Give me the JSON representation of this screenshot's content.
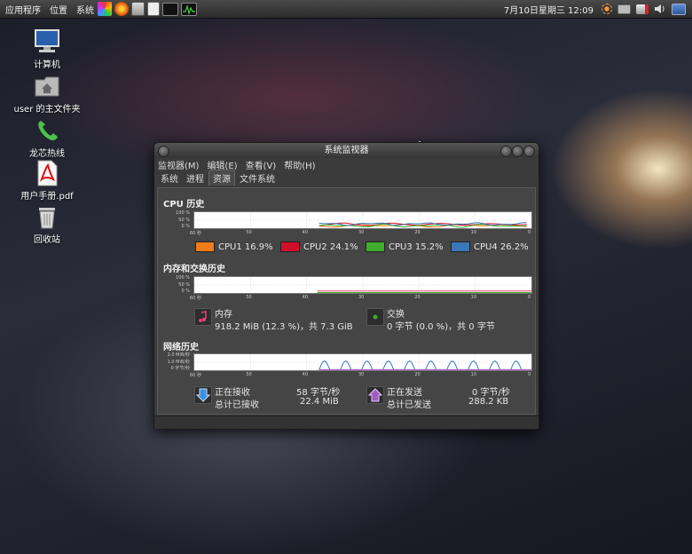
{
  "panel": {
    "menus": [
      "应用程序",
      "位置",
      "系统"
    ],
    "clock": "7月10日星期三 12:09"
  },
  "desktop": {
    "icons": [
      {
        "label": "计算机"
      },
      {
        "label": "user 的主文件夹"
      },
      {
        "label": "龙芯热线"
      },
      {
        "label": "用户手册.pdf"
      },
      {
        "label": "回收站"
      }
    ]
  },
  "window": {
    "title": "系统监视器",
    "menus": [
      "监视器(M)",
      "编辑(E)",
      "查看(V)",
      "帮助(H)"
    ],
    "tabs": [
      "系统",
      "进程",
      "资源",
      "文件系统"
    ],
    "active_tab": "资源"
  },
  "cpu": {
    "title": "CPU 历史",
    "y_ticks": [
      "100 %",
      "50 %",
      "0 %"
    ],
    "x_ticks": [
      "60 秒",
      "50",
      "40",
      "30",
      "20",
      "10",
      "0"
    ],
    "legend": [
      {
        "name": "CPU1",
        "value": "16.9%",
        "color": "#f07b17"
      },
      {
        "name": "CPU2",
        "value": "24.1%",
        "color": "#d0102a"
      },
      {
        "name": "CPU3",
        "value": "15.2%",
        "color": "#3fae2a"
      },
      {
        "name": "CPU4",
        "value": "26.2%",
        "color": "#3a77b8"
      }
    ]
  },
  "memory": {
    "title": "内存和交换历史",
    "y_ticks": [
      "100 %",
      "50 %",
      "0 %"
    ],
    "x_ticks": [
      "60 秒",
      "50",
      "40",
      "30",
      "20",
      "10",
      "0"
    ],
    "mem_label": "内存",
    "mem_value": "918.2 MiB (12.3 %)，共 7.3 GiB",
    "swap_label": "交换",
    "swap_value": "0 字节 (0.0 %)，共 0 字节",
    "mem_color": "#e0407a",
    "swap_color": "#3fae2a"
  },
  "network": {
    "title": "网络历史",
    "y_ticks": [
      "2.0 MiB/秒",
      "1.0 MiB/秒",
      "0 字节/秒"
    ],
    "x_ticks": [
      "60 秒",
      "50",
      "40",
      "30",
      "20",
      "10",
      "0"
    ],
    "recv_label": "正在接收",
    "recv_rate": "58 字节/秒",
    "total_recv_label": "总计已接收",
    "total_recv": "22.4 MiB",
    "send_label": "正在发送",
    "send_rate": "0 字节/秒",
    "total_send_label": "总计已发送",
    "total_send": "288.2 KB",
    "recv_color": "#3a77b8",
    "send_color": "#a25cc0"
  }
}
